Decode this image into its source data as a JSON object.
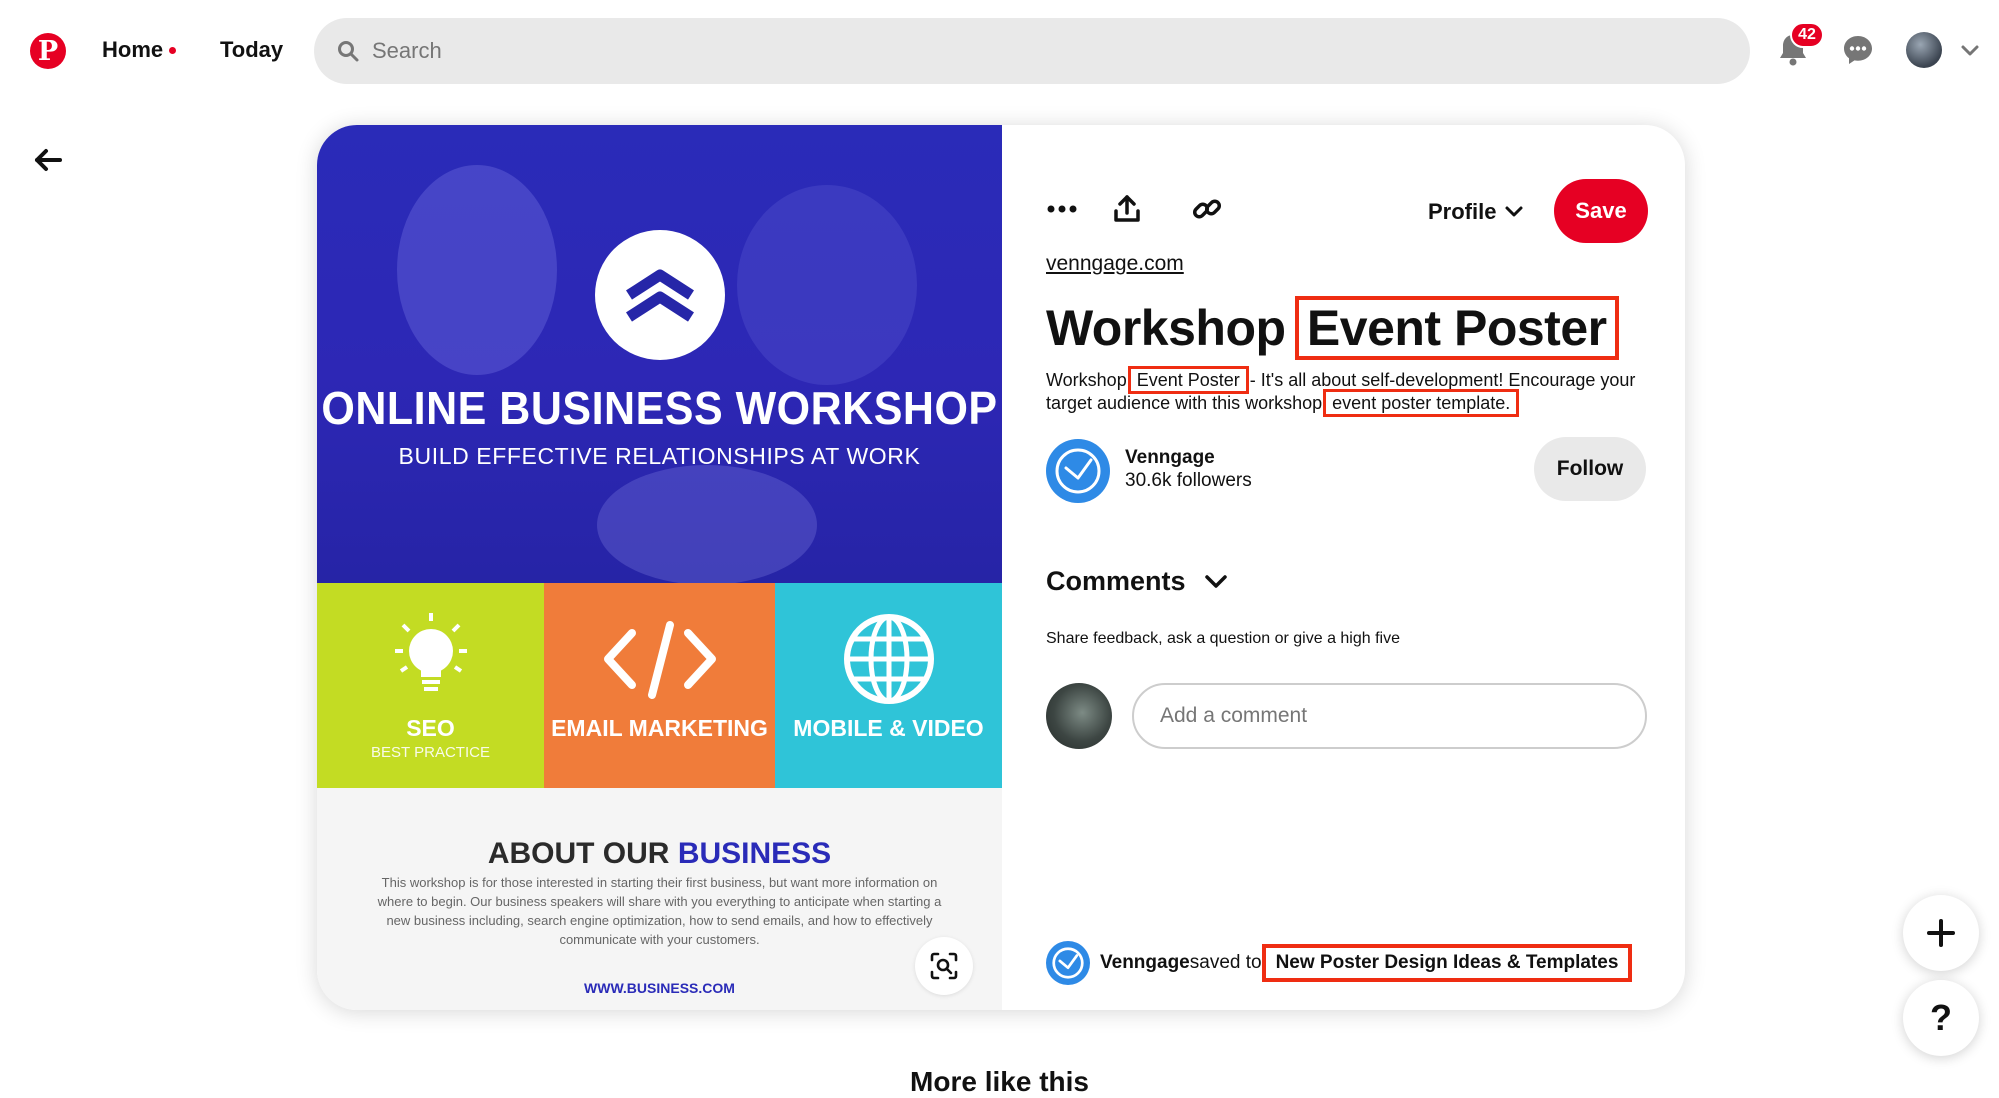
{
  "nav": {
    "home_label": "Home",
    "today_label": "Today",
    "search_placeholder": "Search",
    "notification_count": "42"
  },
  "poster": {
    "title": "ONLINE BUSINESS WORKSHOP",
    "subtitle": "BUILD EFFECTIVE RELATIONSHIPS AT WORK",
    "tiles": [
      {
        "label": "SEO",
        "sub": "BEST PRACTICE",
        "color": "#c3dc23"
      },
      {
        "label": "EMAIL MARKETING",
        "color": "#f07c3a"
      },
      {
        "label": "MOBILE & VIDEO",
        "color": "#2fc4d8"
      }
    ],
    "about_title_a": "ABOUT OUR ",
    "about_title_b": "BUSINESS",
    "about_text": "This workshop is for those interested in starting their first business, but want more information on where to begin. Our business speakers will share with you everything to anticipate when starting a new business including, search engine optimization, how to send emails, and how to effectively communicate with your customers.",
    "url": "WWW.BUSINESS.COM",
    "primary_color": "#2a2bb8"
  },
  "pin": {
    "profile_label": "Profile",
    "save_label": "Save",
    "source": "venngage.com",
    "title_a": "Workshop ",
    "title_b": "Event Poster",
    "desc_a": "Workshop ",
    "desc_b": "Event Poster",
    "desc_c": " - It's all about self-development! Encourage your target audience with this workshop ",
    "desc_d": "event poster template.",
    "creator_name": "Venngage",
    "creator_followers": "30.6k followers",
    "follow_label": "Follow",
    "comments_label": "Comments",
    "comments_hint": "Share feedback, ask a question or give a high five",
    "comment_placeholder": "Add a comment",
    "saved_user": "Venngage",
    "saved_text": " saved to ",
    "board_name": "New Poster Design Ideas & Templates",
    "highlight_color": "#ef2d12",
    "brand_color": "#e60023"
  },
  "floating": {
    "plus": "+",
    "help": "?"
  },
  "more_like_this": "More like this"
}
